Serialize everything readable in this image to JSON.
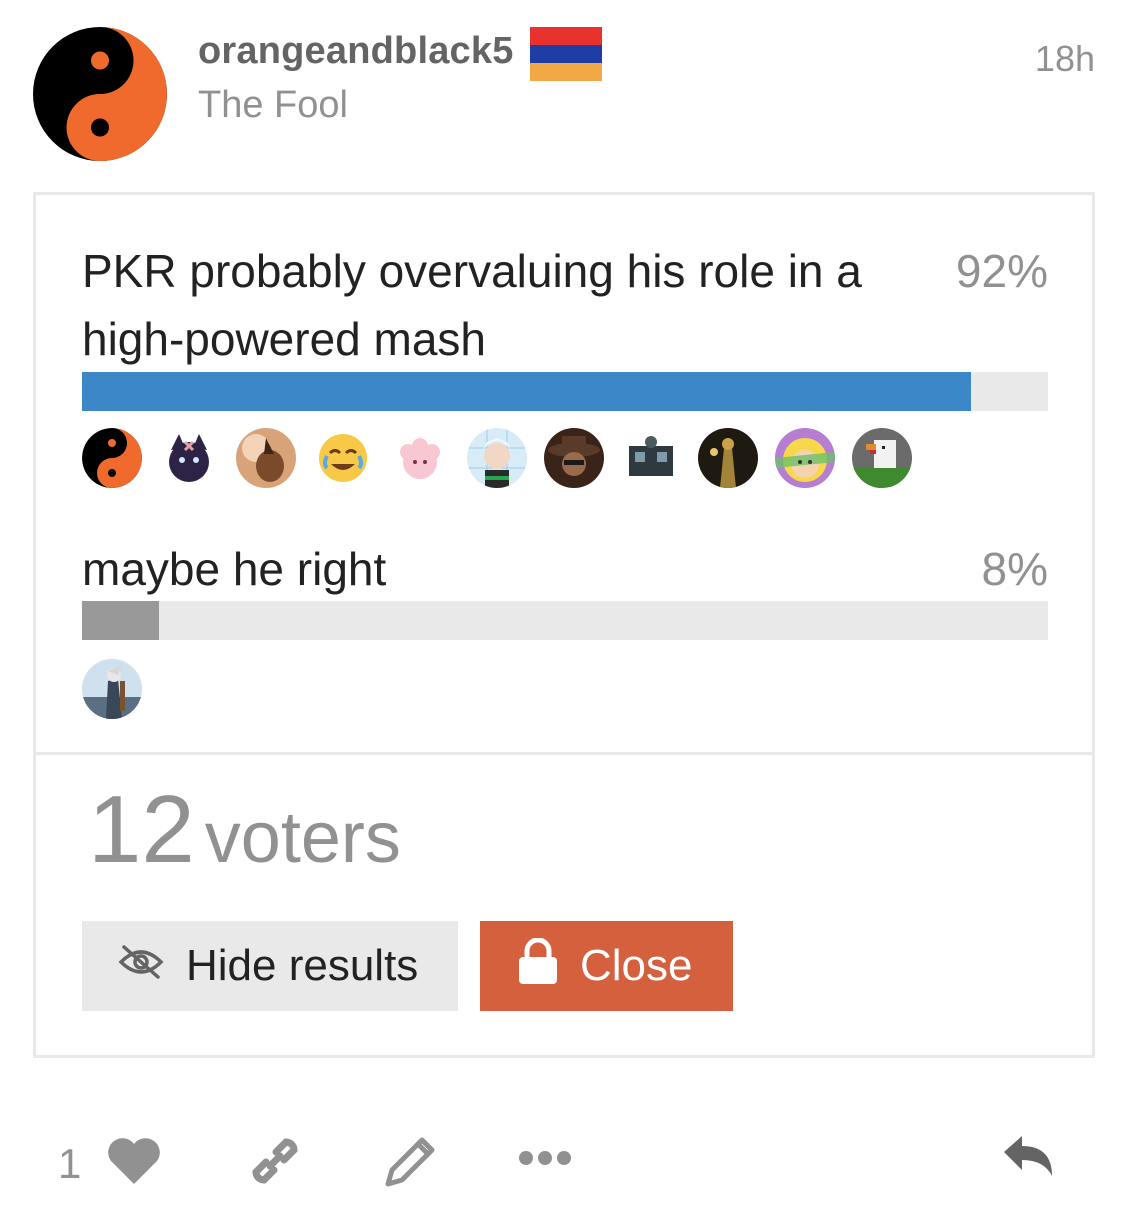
{
  "post": {
    "username": "orangeandblack5",
    "user_title": "The Fool",
    "date": "18h",
    "flag_colors": [
      "#e8322e",
      "#1f3ea5",
      "#f2a844"
    ],
    "avatar": "yin-yang-avatar"
  },
  "poll": {
    "options": [
      {
        "text": "PKR probably overvaluing his role in a high-powered mash",
        "percent": "92%",
        "value": 0.92,
        "bar_color": "#3c87c8",
        "voter_count_shown": 11
      },
      {
        "text": "maybe he right",
        "percent": "8%",
        "value": 0.08,
        "bar_color": "#999999",
        "voter_count_shown": 1
      }
    ],
    "voters_number": "12",
    "voters_label": "voters",
    "hide_results_label": "Hide results",
    "close_label": "Close",
    "close_color": "#d4603e"
  },
  "controls": {
    "like_count": "1",
    "icons": [
      "heart-icon",
      "link-icon",
      "pencil-icon",
      "more-icon",
      "reply-icon"
    ]
  }
}
